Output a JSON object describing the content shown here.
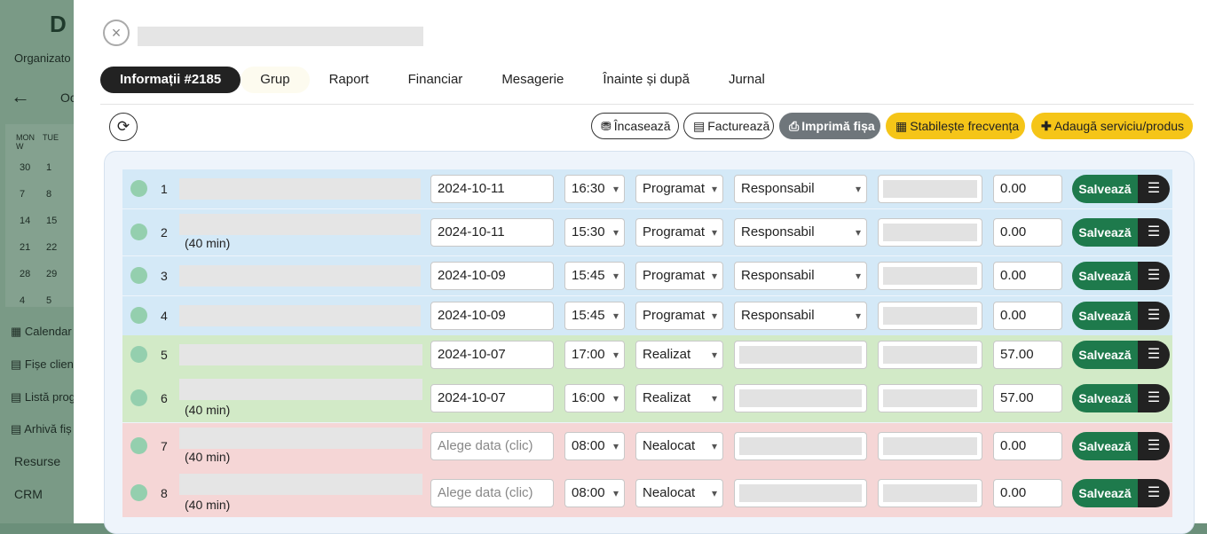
{
  "background": {
    "logo": "D",
    "org_label": "Organizato",
    "month_label": "Oc",
    "weekdays": [
      "MON",
      "TUE",
      "W"
    ],
    "calendar_rows": [
      [
        "30",
        "1"
      ],
      [
        "7",
        "8"
      ],
      [
        "14",
        "15"
      ],
      [
        "21",
        "22"
      ],
      [
        "28",
        "29"
      ],
      [
        "4",
        "5"
      ]
    ],
    "nav": [
      "Calendar",
      "Fișe clien",
      "Listă prog",
      "Arhivă fiș"
    ],
    "plain": [
      "Resurse",
      "CRM"
    ]
  },
  "modal": {
    "close_icon": "×",
    "tabs": [
      "Informații #2185",
      "Grup",
      "Raport",
      "Financiar",
      "Mesagerie",
      "Înainte și după",
      "Jurnal"
    ],
    "refresh_icon": "⟳",
    "actions": {
      "collect": "Încasează",
      "invoice": "Facturează",
      "print": "Imprimă fișa",
      "frequency": "Stabilește frecvența",
      "add": "Adaugă serviciu/produs"
    },
    "save_label": "Salvează",
    "menu_icon": "☰",
    "colors": {
      "blue_row": "#d4e9f7",
      "green_row": "#d2eac7",
      "red_row": "#f5d6d6",
      "save": "#1e7a4c",
      "yellow": "#f5c518"
    },
    "rows": [
      {
        "num": "1",
        "duration": "",
        "date": "2024-10-11",
        "time": "16:30",
        "status": "Programat",
        "resp": "Responsabil",
        "amount": "0.00",
        "tone": "blue"
      },
      {
        "num": "2",
        "duration": "(40 min)",
        "date": "2024-10-11",
        "time": "15:30",
        "status": "Programat",
        "resp": "Responsabil",
        "amount": "0.00",
        "tone": "blue"
      },
      {
        "num": "3",
        "duration": "",
        "date": "2024-10-09",
        "time": "15:45",
        "status": "Programat",
        "resp": "Responsabil",
        "amount": "0.00",
        "tone": "blue"
      },
      {
        "num": "4",
        "duration": "",
        "date": "2024-10-09",
        "time": "15:45",
        "status": "Programat",
        "resp": "Responsabil",
        "amount": "0.00",
        "tone": "blue"
      },
      {
        "num": "5",
        "duration": "",
        "date": "2024-10-07",
        "time": "17:00",
        "status": "Realizat",
        "resp": "",
        "amount": "57.00",
        "tone": "green"
      },
      {
        "num": "6",
        "duration": "(40 min)",
        "date": "2024-10-07",
        "time": "16:00",
        "status": "Realizat",
        "resp": "",
        "amount": "57.00",
        "tone": "green"
      },
      {
        "num": "7",
        "duration": "(40 min)",
        "date_placeholder": "Alege data (clic)",
        "time": "08:00",
        "status": "Nealocat",
        "resp": "",
        "amount": "0.00",
        "tone": "red"
      },
      {
        "num": "8",
        "duration": "(40 min)",
        "date_placeholder": "Alege data (clic)",
        "time": "08:00",
        "status": "Nealocat",
        "resp": "",
        "amount": "0.00",
        "tone": "red"
      }
    ]
  }
}
